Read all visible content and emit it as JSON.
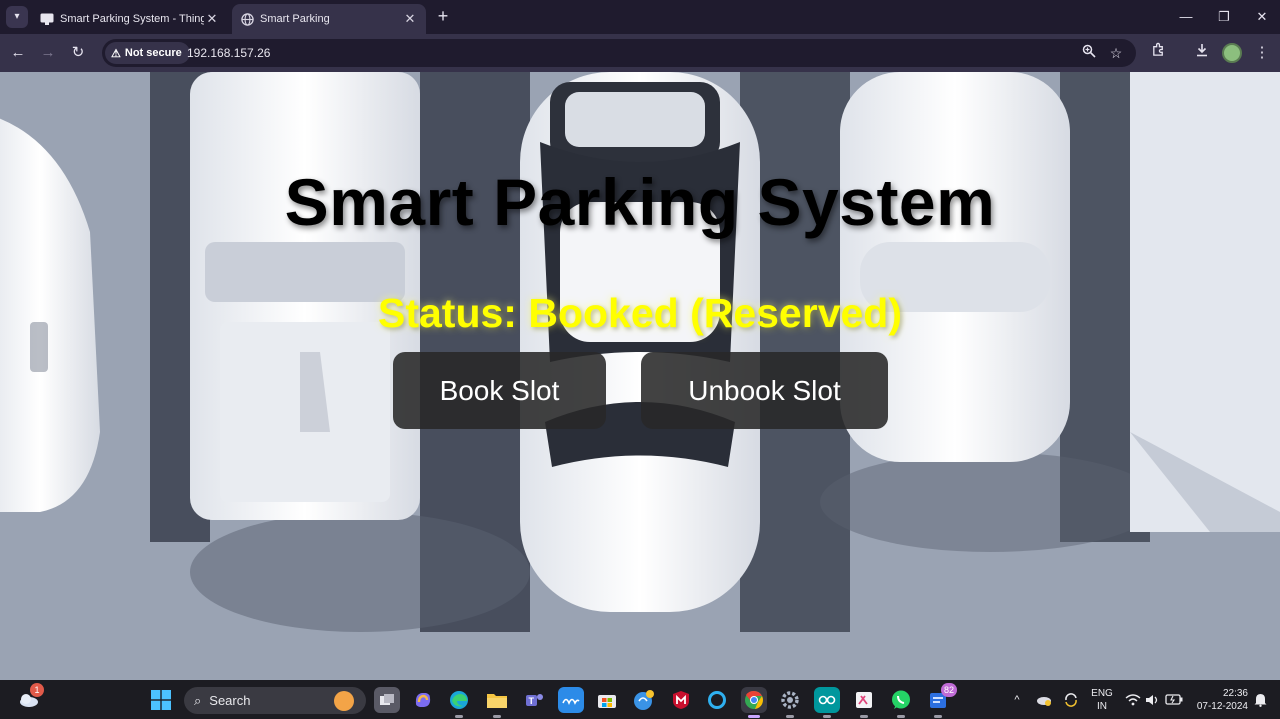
{
  "browser": {
    "tabs": [
      {
        "title": "Smart Parking System - ThingSp",
        "active": false
      },
      {
        "title": "Smart Parking",
        "active": true
      }
    ],
    "security_label": "Not secure",
    "url": "192.168.157.26"
  },
  "page": {
    "heading": "Smart Parking System",
    "status_text": "Status: Booked (Reserved)",
    "book_button": "Book Slot",
    "unbook_button": "Unbook Slot",
    "status_color": "#ffff00"
  },
  "taskbar": {
    "weather_badge": "1",
    "search_label": "Search",
    "apps": [
      "file-explorer",
      "copilot",
      "edge",
      "file-manager",
      "teams",
      "mylp",
      "store",
      "chrome-sync",
      "mcafee",
      "cortana",
      "chrome",
      "settings",
      "arduino",
      "snipping-tool",
      "whatsapp",
      "todo"
    ],
    "todo_badge": "82",
    "language_line1": "ENG",
    "language_line2": "IN",
    "time": "22:36",
    "date": "07-12-2024"
  }
}
